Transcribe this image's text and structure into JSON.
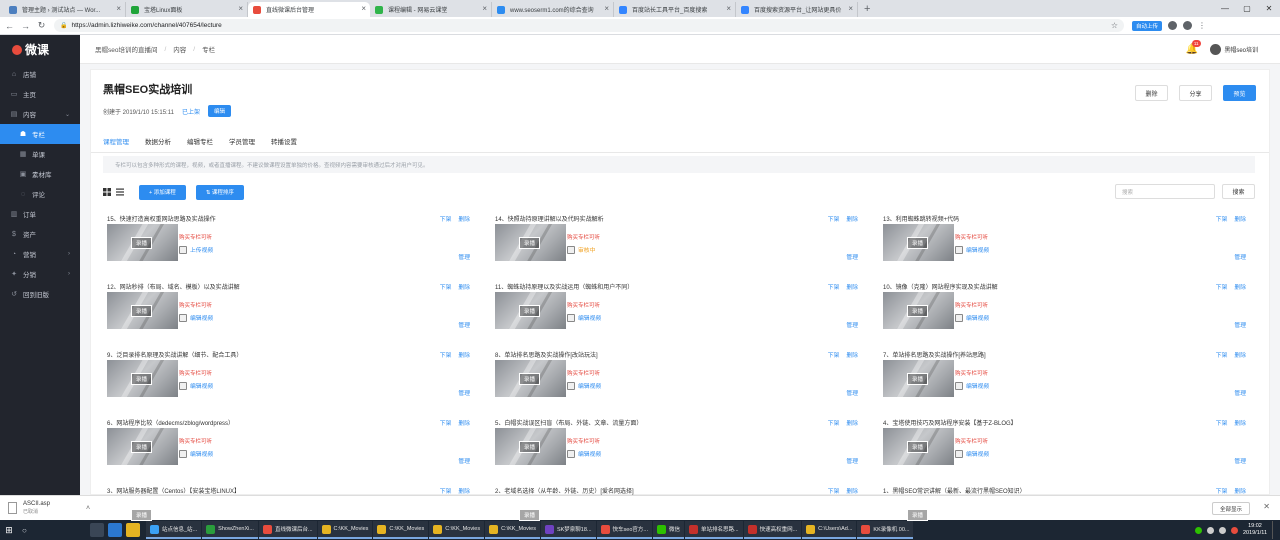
{
  "browser": {
    "tabs": [
      {
        "title": "管理主题 › 测试站点 — Wor...",
        "color": "#4c7fbf",
        "active": false
      },
      {
        "title": "宝塔Linux面板",
        "color": "#20a53a",
        "active": false
      },
      {
        "title": "直线微课后台管理",
        "color": "#e84c3d",
        "active": true
      },
      {
        "title": "课程编辑 - 网易云课堂",
        "color": "#2fb44a",
        "active": false
      },
      {
        "title": "www.seoserm1.com的综合查询",
        "color": "#2d8cf0",
        "active": false
      },
      {
        "title": "百度站长工具平台_百度搜索",
        "color": "#3385ff",
        "active": false
      },
      {
        "title": "百度搜索资源平台_让网站更具价",
        "color": "#3385ff",
        "active": false
      }
    ],
    "new_tab": "+",
    "url": "https://admin.lizhiweike.com/channel/407654/lecture",
    "extension_button": "自动上传"
  },
  "sidebar": {
    "logo": "微课",
    "items": [
      {
        "icon": "shop-icon",
        "glyph": "⌂",
        "label": "店铺",
        "arrow": "",
        "active": false,
        "sub": false
      },
      {
        "icon": "monitor-icon",
        "glyph": "▭",
        "label": "主页",
        "arrow": "",
        "active": false,
        "sub": false
      },
      {
        "icon": "content-icon",
        "glyph": "▤",
        "label": "内容",
        "arrow": "⌄",
        "active": false,
        "sub": false
      },
      {
        "icon": "column-icon",
        "glyph": "☗",
        "label": "专栏",
        "arrow": "",
        "active": true,
        "sub": true
      },
      {
        "icon": "lesson-icon",
        "glyph": "▦",
        "label": "单课",
        "arrow": "",
        "active": false,
        "sub": true
      },
      {
        "icon": "library-icon",
        "glyph": "▣",
        "label": "素材库",
        "arrow": "",
        "active": false,
        "sub": true
      },
      {
        "icon": "comment-icon",
        "glyph": "◌",
        "label": "评论",
        "arrow": "",
        "active": false,
        "sub": true
      },
      {
        "icon": "order-icon",
        "glyph": "▥",
        "label": "订单",
        "arrow": "",
        "active": false,
        "sub": false
      },
      {
        "icon": "asset-icon",
        "glyph": "$",
        "label": "资产",
        "arrow": "",
        "active": false,
        "sub": false
      },
      {
        "icon": "marketing-icon",
        "glyph": "◔",
        "label": "营销",
        "arrow": "›",
        "active": false,
        "sub": false
      },
      {
        "icon": "distribution-icon",
        "glyph": "✦",
        "label": "分销",
        "arrow": "›",
        "active": false,
        "sub": false
      },
      {
        "icon": "back-icon",
        "glyph": "↺",
        "label": "回到旧版",
        "arrow": "",
        "active": false,
        "sub": false
      }
    ]
  },
  "header": {
    "breadcrumb": [
      "黑帽seo培训的直播间",
      "内容",
      "专栏"
    ],
    "notification_count": "11",
    "username": "黑帽seo培训"
  },
  "course": {
    "title": "黑帽SEO实战培训",
    "created": "创建于 2019/1/10 15:15:11",
    "status": "已上架",
    "edit_label": "编辑",
    "actions": {
      "delete": "删除",
      "share": "分享",
      "preview": "预览"
    },
    "tabs": [
      "课程管理",
      "数据分析",
      "编辑专栏",
      "学员管理",
      "转播设置"
    ],
    "notice": "专栏可以包含多种形式的课程，视频，或者直播课程。不建议做课程设置单独的价格。查视频内容需要审核通过后才对用户可见。",
    "add_lesson": "+ 添加课程",
    "sort_lessons": "⇅ 课程排序",
    "search_placeholder": "搜索",
    "search_button": "搜索"
  },
  "lessons": [
    {
      "title": "15、快速打造高权重网站思路及实战操作",
      "status": "上传视频",
      "review": false
    },
    {
      "title": "14、快照劫持原理讲解以及代码实战解析",
      "status": "审核中",
      "review": true
    },
    {
      "title": "13、利用蜘蛛跳转视频+代码",
      "status": "编辑视频",
      "review": false
    },
    {
      "title": "12、网站秒排（布局、域名、模板）以及实战讲解",
      "status": "编辑视频",
      "review": false
    },
    {
      "title": "11、蜘蛛劫持原理以及实战运用（蜘蛛和用户不同）",
      "status": "编辑视频",
      "review": false
    },
    {
      "title": "10、镜像（克隆）网站程序实现及实战讲解",
      "status": "编辑视频",
      "review": false
    },
    {
      "title": "9、泛目录排名原理及实战讲解（细节、配合工具）",
      "status": "编辑视频",
      "review": false
    },
    {
      "title": "8、单站排名思路及实战操作[改站玩法]",
      "status": "编辑视频",
      "review": false
    },
    {
      "title": "7、单站排名思路及实战操作[养站思路]",
      "status": "编辑视频",
      "review": false
    },
    {
      "title": "6、网站程序比较（dedecms/zblog/wordpress）",
      "status": "编辑视频",
      "review": false
    },
    {
      "title": "5、白帽实战误区扫盲（布局、外链、文章、流量方面）",
      "status": "编辑视频",
      "review": false
    },
    {
      "title": "4、宝塔使用技巧及网站程序安装【基于Z-BLOG】",
      "status": "编辑视频",
      "review": false
    },
    {
      "title": "3、网站服务器配置（Centos）【安装宝塔LINUX】",
      "status": "",
      "review": false
    },
    {
      "title": "2、老域名选择（从年龄、外链、历史）[爱名网选择]",
      "status": "",
      "review": false
    },
    {
      "title": "1、黑帽SEO常识讲解（最新、最流行黑帽SEO知识）",
      "status": "",
      "review": false
    }
  ],
  "lesson_labels": {
    "pill": "录播",
    "permission": "购买专栏可听",
    "unpublish": "下架",
    "delete": "删除",
    "manage": "管理"
  },
  "download": {
    "file": "ASCII.asp",
    "status": "已取消",
    "show_all": "全部显示"
  },
  "taskbar": {
    "items": [
      {
        "label": "站点信息_站...",
        "color": "#3ba1f5"
      },
      {
        "label": "ShowZhenXi...",
        "color": "#2a9d3c"
      },
      {
        "label": "直线微课后台...",
        "color": "#e84c3d"
      },
      {
        "label": "C:\\KK_Movies",
        "color": "#e6b422"
      },
      {
        "label": "C:\\KK_Movies",
        "color": "#e6b422"
      },
      {
        "label": "C:\\KK_Movies",
        "color": "#e6b422"
      },
      {
        "label": "C:\\KK_Movies",
        "color": "#e6b422"
      },
      {
        "label": "SK梦泉聊18...",
        "color": "#6f42c1"
      },
      {
        "label": "快车seo官方...",
        "color": "#e84c3d"
      },
      {
        "label": "微信",
        "color": "#2dc100"
      },
      {
        "label": "单站排名思路...",
        "color": "#c4302b"
      },
      {
        "label": "快速高权重网...",
        "color": "#c4302b"
      },
      {
        "label": "C:\\Users\\Ad...",
        "color": "#e6b422"
      },
      {
        "label": "KK录像机 00...",
        "color": "#e84c3d"
      }
    ],
    "time": "19:02",
    "date": "2019/1/11"
  }
}
